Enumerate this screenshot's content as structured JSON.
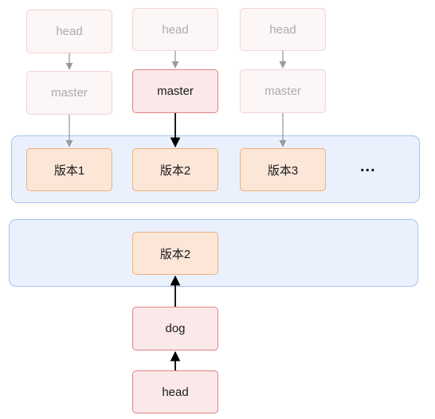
{
  "top_group": {
    "branches": [
      {
        "head_label": "head",
        "master_label": "master",
        "version_label": "版本1",
        "active": false
      },
      {
        "head_label": "head",
        "master_label": "master",
        "version_label": "版本2",
        "active": true
      },
      {
        "head_label": "head",
        "master_label": "master",
        "version_label": "版本3",
        "active": false
      }
    ],
    "ellipsis": "..."
  },
  "bottom_group": {
    "version_label": "版本2",
    "branch_label": "dog",
    "head_label": "head"
  },
  "colors": {
    "container_fill": "#eaf1fd",
    "container_border": "#a9c2ef",
    "version_fill": "#fbe6d8",
    "version_border": "#f0b07a",
    "ref_fill": "#fbe9ea",
    "ref_border": "#e5807e",
    "faded_arrow": "#9a9a9a",
    "active_arrow": "#000000"
  }
}
